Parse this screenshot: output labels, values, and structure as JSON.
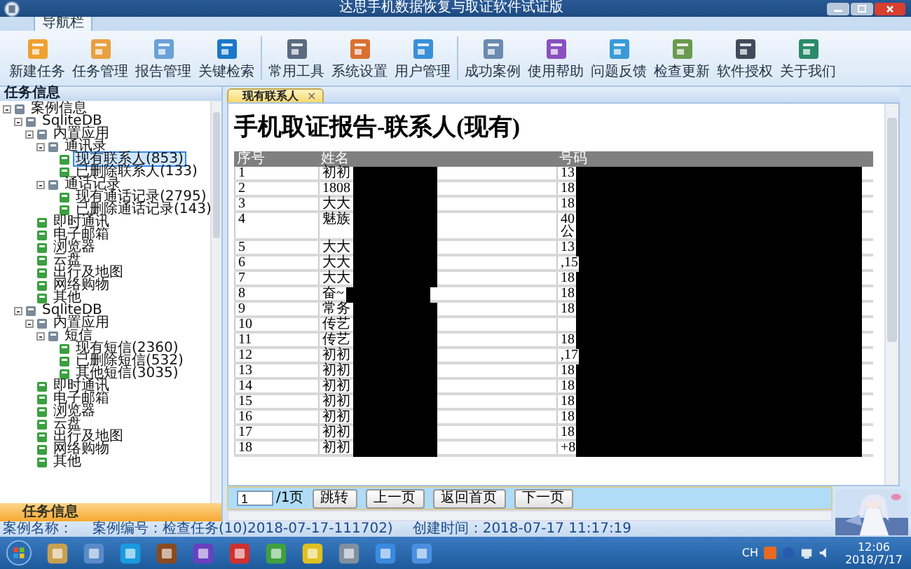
{
  "window": {
    "title": "达思手机数据恢复与取证软件试证版"
  },
  "ribbon": {
    "tabs": [
      {
        "label": "导航栏",
        "selected": true
      }
    ],
    "groups": [
      [
        "新建任务",
        "任务管理",
        "报告管理",
        "关键检索"
      ],
      [
        "常用工具",
        "系统设置",
        "用户管理"
      ],
      [
        "成功案例",
        "使用帮助",
        "问题反馈",
        "检查更新",
        "软件授权",
        "关于我们"
      ]
    ]
  },
  "left_panel": {
    "title": "任务信息",
    "footer": "任务信息",
    "tree": [
      {
        "label": "案例信息",
        "expanded": true,
        "selected": false,
        "children": [
          {
            "label": "SqliteDB",
            "expanded": true,
            "selected": false,
            "children": [
              {
                "label": "内置应用",
                "expanded": true,
                "selected": false,
                "children": [
                  {
                    "label": "通讯录",
                    "expanded": true,
                    "selected": false,
                    "children": [
                      {
                        "label": "现有联系人(853)",
                        "selected": true
                      },
                      {
                        "label": "已删除联系人(133)",
                        "selected": false
                      }
                    ]
                  },
                  {
                    "label": "通话记录",
                    "expanded": true,
                    "selected": false,
                    "children": [
                      {
                        "label": "现有通话记录(2795)",
                        "selected": false
                      },
                      {
                        "label": "已删除通话记录(143)",
                        "selected": false
                      }
                    ]
                  }
                ]
              },
              {
                "label": "即时通讯",
                "selected": false
              },
              {
                "label": "电子邮箱",
                "selected": false
              },
              {
                "label": "浏览器",
                "selected": false
              },
              {
                "label": "云盘",
                "selected": false
              },
              {
                "label": "出行及地图",
                "selected": false
              },
              {
                "label": "网络购物",
                "selected": false
              },
              {
                "label": "其他",
                "selected": false
              }
            ]
          },
          {
            "label": "SqliteDB",
            "expanded": true,
            "selected": false,
            "children": [
              {
                "label": "内置应用",
                "expanded": true,
                "selected": false,
                "children": [
                  {
                    "label": "短信",
                    "expanded": true,
                    "selected": false,
                    "children": [
                      {
                        "label": "现有短信(2360)",
                        "selected": false
                      },
                      {
                        "label": "已删除短信(532)",
                        "selected": false
                      },
                      {
                        "label": "其他短信(3035)",
                        "selected": false
                      }
                    ]
                  }
                ]
              },
              {
                "label": "即时通讯",
                "selected": false
              },
              {
                "label": "电子邮箱",
                "selected": false
              },
              {
                "label": "浏览器",
                "selected": false
              },
              {
                "label": "云盘",
                "selected": false
              },
              {
                "label": "出行及地图",
                "selected": false
              },
              {
                "label": "网络购物",
                "selected": false
              },
              {
                "label": "其他",
                "selected": false
              }
            ]
          }
        ]
      }
    ]
  },
  "document_tabs": [
    {
      "label": "现有联系人",
      "selected": true,
      "close": "×"
    }
  ],
  "report": {
    "title": "手机取证报告-联系人(现有)",
    "columns": [
      "序号",
      "姓名",
      "号码"
    ],
    "rows": [
      {
        "index": "1",
        "name": "初初",
        "number": "13",
        "redacted": true
      },
      {
        "index": "2",
        "name": "1808",
        "number": "18",
        "redacted": true
      },
      {
        "index": "3",
        "name": "大大",
        "number": "18",
        "redacted": true
      },
      {
        "index": "4",
        "name": "魅族",
        "number": "40\n公",
        "redacted": true
      },
      {
        "index": "5",
        "name": "大大",
        "number": "13",
        "redacted": true
      },
      {
        "index": "6",
        "name": "大大",
        "number": ",15",
        "redacted": true
      },
      {
        "index": "7",
        "name": "大大",
        "number": "18",
        "redacted": true
      },
      {
        "index": "8",
        "name": "奋~",
        "number": "18",
        "redacted": true
      },
      {
        "index": "9",
        "name": "常务",
        "number": "18",
        "redacted": true
      },
      {
        "index": "10",
        "name": "传艺",
        "redacted": true
      },
      {
        "index": "11",
        "name": "传艺",
        "number": "18",
        "redacted": true
      },
      {
        "index": "12",
        "name": "初初",
        "number": ",17",
        "redacted": true
      },
      {
        "index": "13",
        "name": "初初",
        "number": "18",
        "redacted": true
      },
      {
        "index": "14",
        "name": "初初",
        "number": "18",
        "redacted": true
      },
      {
        "index": "15",
        "name": "初初",
        "number": "18",
        "redacted": true
      },
      {
        "index": "16",
        "name": "初初",
        "number": "18",
        "redacted": true
      },
      {
        "index": "17",
        "name": "初初",
        "number": "18",
        "redacted": true
      },
      {
        "index": "18",
        "name": "初初",
        "number": "+8",
        "redacted": true
      }
    ]
  },
  "pagination": {
    "page": "1",
    "total": "/1页",
    "buttons": [
      "跳转",
      "上一页",
      "返回首页",
      "下一页"
    ]
  },
  "status_bar": [
    "案例名称：",
    "案例编号：检查任务(10)2018-07-17-111702)",
    "创建时间：2018-07-17 11:17:19"
  ],
  "taskbar": {
    "language": "CH",
    "time": "12:06",
    "date": "2018/7/17"
  }
}
